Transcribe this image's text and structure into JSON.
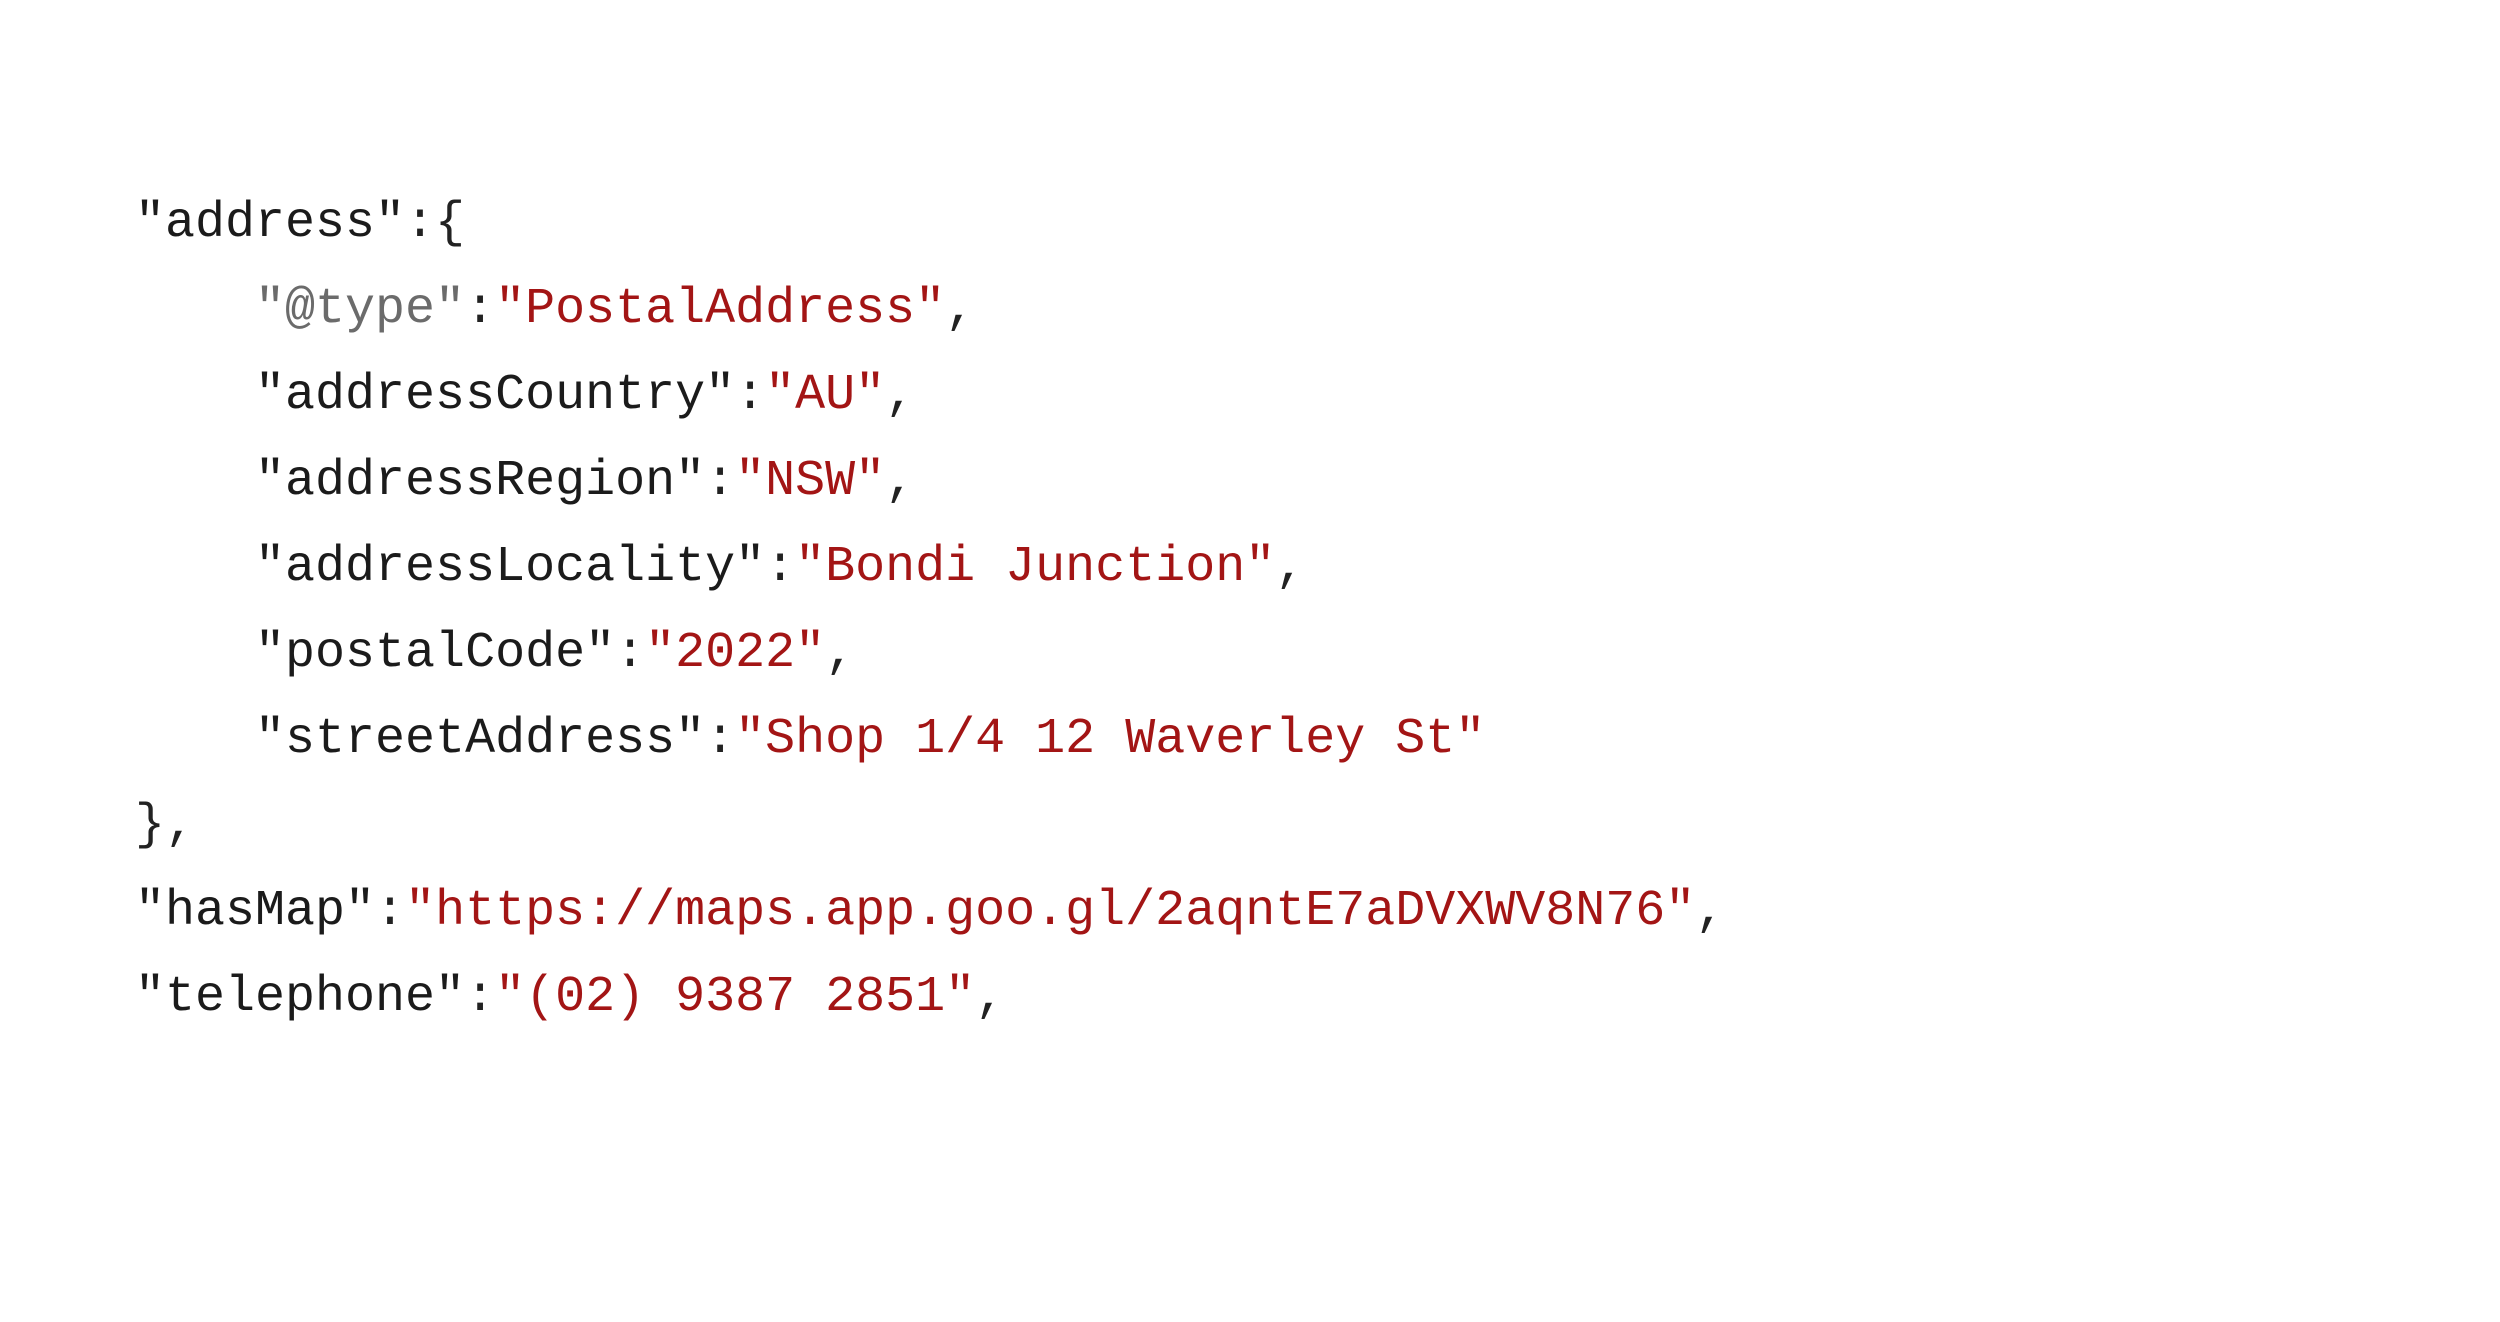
{
  "lines": {
    "l1": {
      "key": "\"address\"",
      "punc": ":{"
    },
    "l2": {
      "at": "\"@type\"",
      "punc1": ":",
      "str": "\"PostalAddress\"",
      "punc2": ","
    },
    "l3": {
      "key": "\"addressCountry\"",
      "punc1": ":",
      "str": "\"AU\"",
      "punc2": ","
    },
    "l4": {
      "key": "\"addressRegion\"",
      "punc1": ":",
      "str": "\"NSW\"",
      "punc2": ","
    },
    "l5": {
      "key": "\"addressLocality\"",
      "punc1": ":",
      "str": "\"Bondi Junction\"",
      "punc2": ","
    },
    "l6": {
      "key": "\"postalCode\"",
      "punc1": ":",
      "str": "\"2022\"",
      "punc2": ","
    },
    "l7": {
      "key": "\"streetAddress\"",
      "punc1": ":",
      "str": "\"Shop 1/4 12 Waverley St\""
    },
    "l8": {
      "punc": "},"
    },
    "l9": {
      "key": "\"hasMap\"",
      "punc1": ":",
      "str": "\"https://maps.app.goo.gl/2aqntE7aDVXWV8N76\"",
      "punc2": ","
    },
    "l10": {
      "key": "\"telephone\"",
      "punc1": ":",
      "str": "\"(02) 9387 2851\"",
      "punc2": ","
    }
  }
}
